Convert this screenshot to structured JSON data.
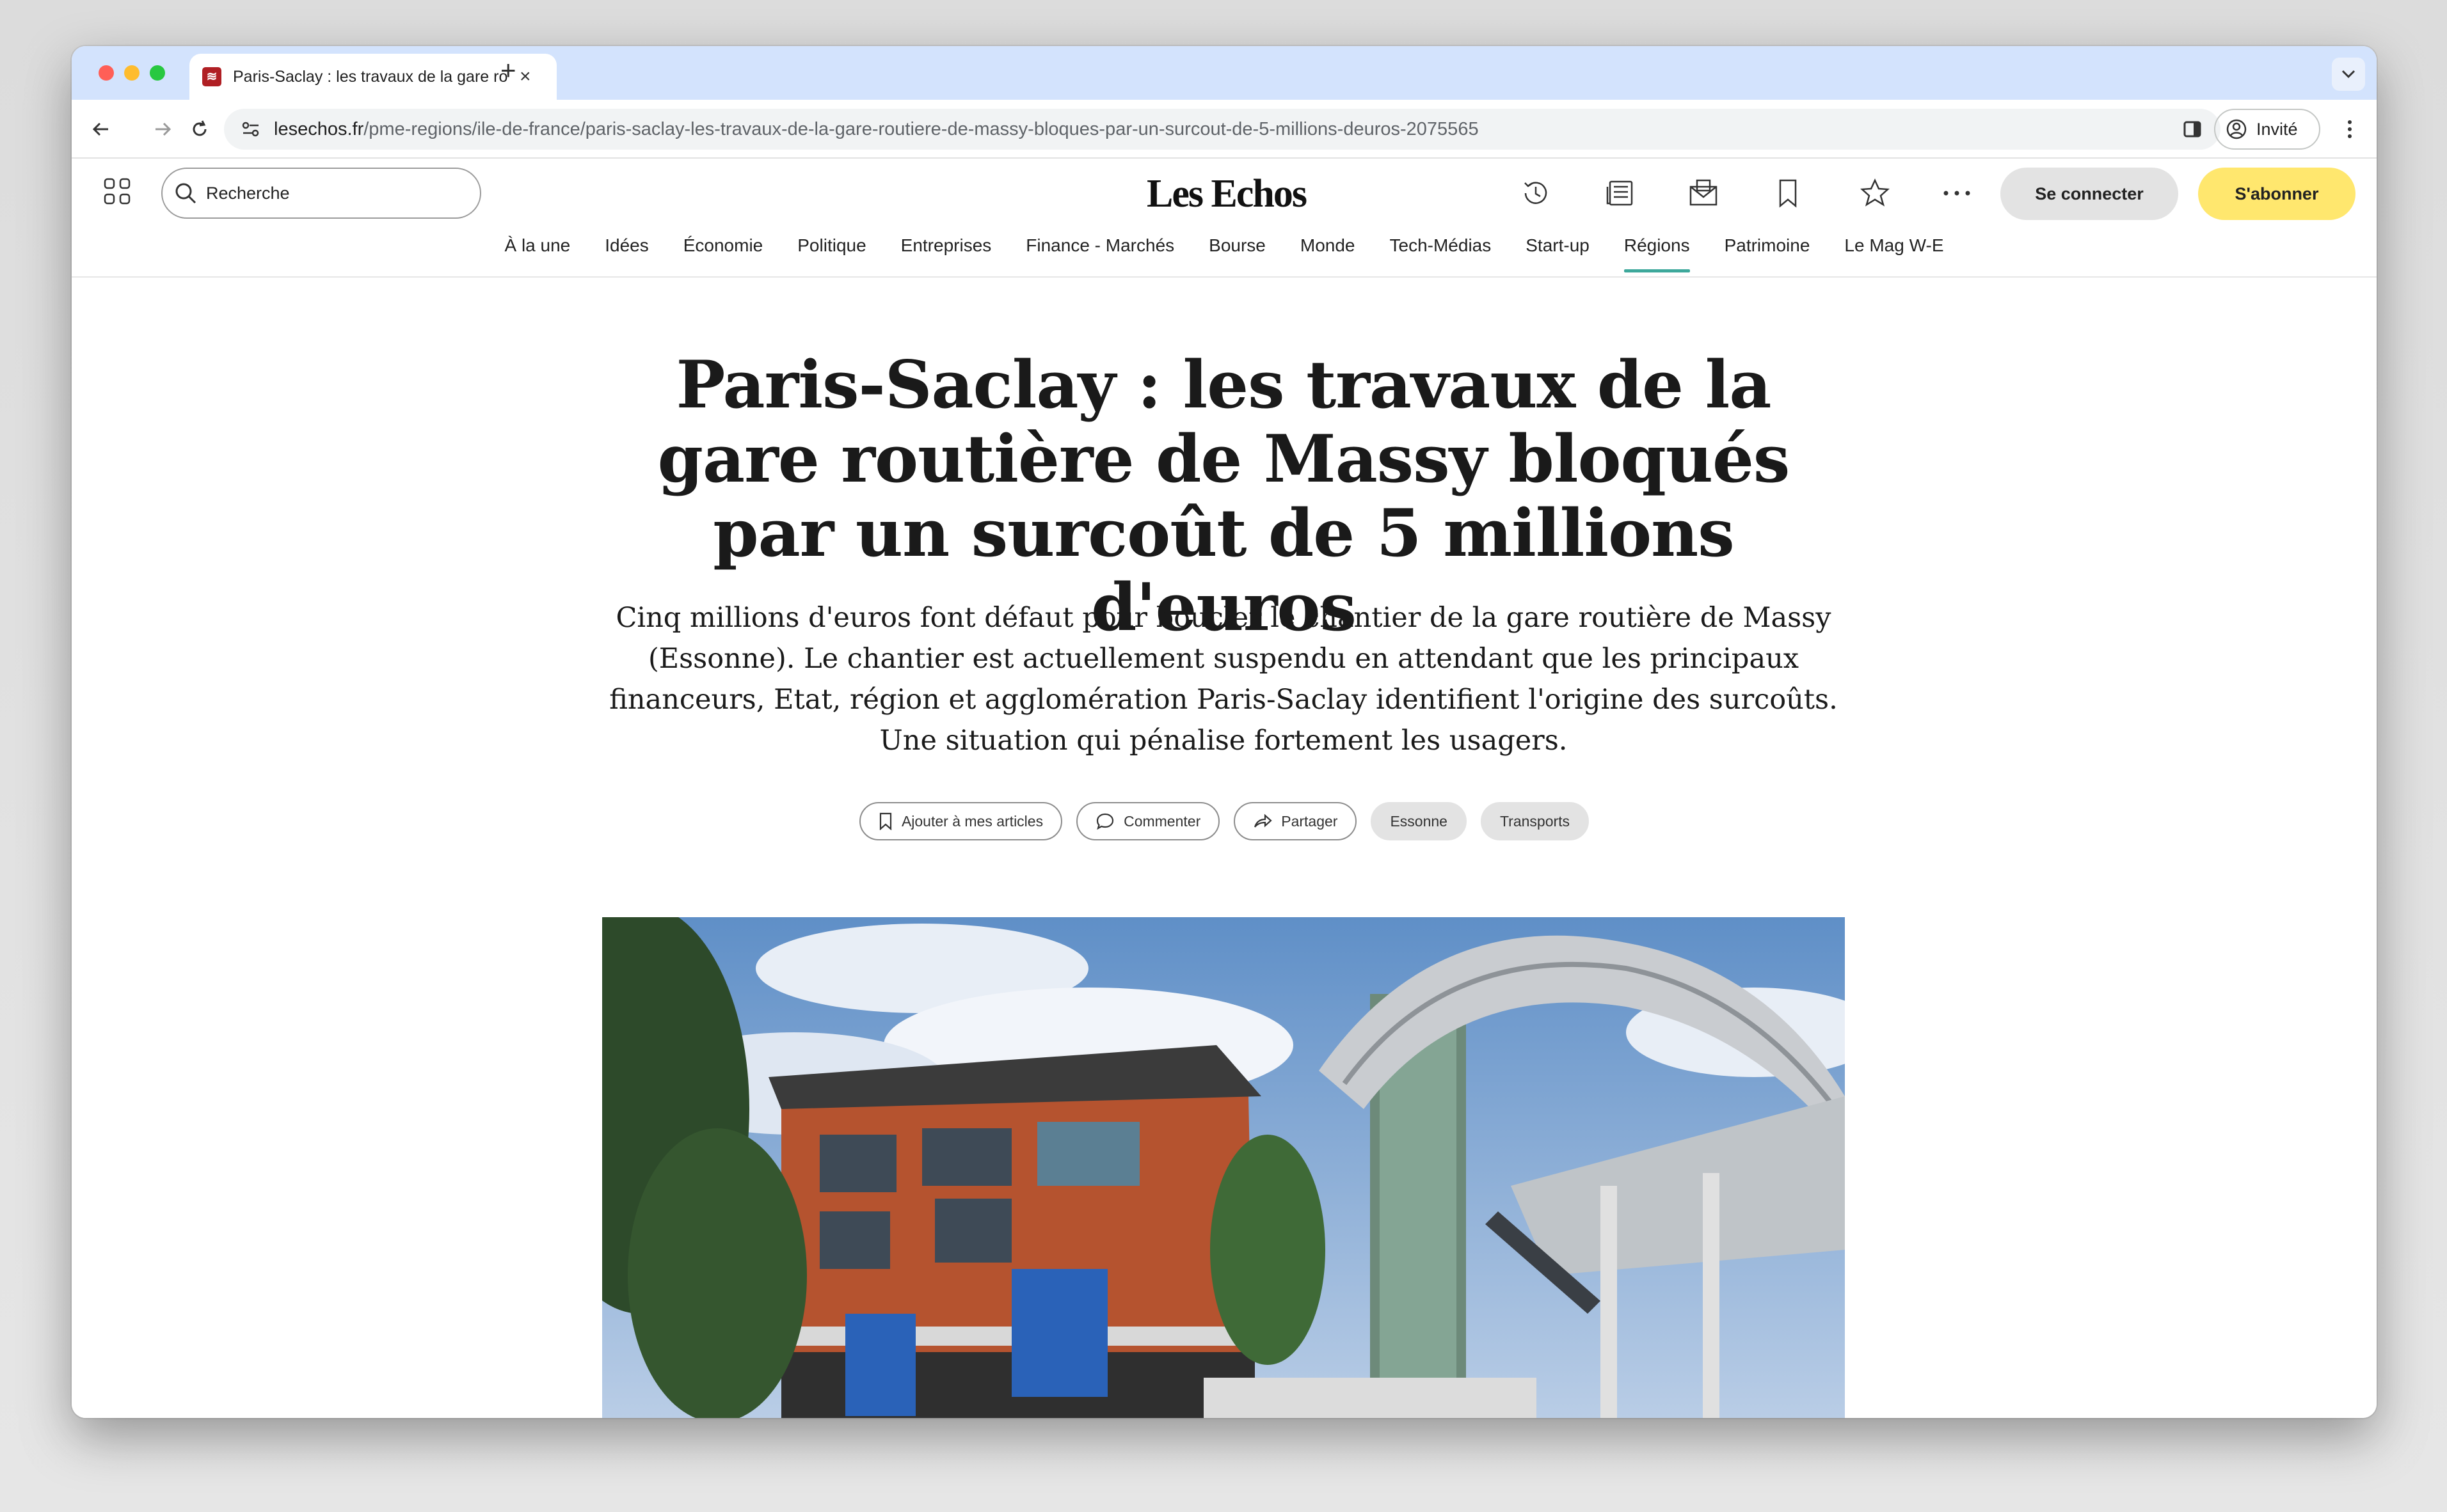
{
  "browser": {
    "tab_title": "Paris-Saclay : les travaux de la gare routière",
    "url_host": "lesechos.fr",
    "url_path": "/pme-regions/ile-de-france/paris-saclay-les-travaux-de-la-gare-routiere-de-massy-bloques-par-un-surcout-de-5-millions-deuros-2075565",
    "profile_label": "Invité"
  },
  "site": {
    "logo": "Les Echos",
    "search_placeholder": "Recherche",
    "connect_label": "Se connecter",
    "subscribe_label": "S'abonner",
    "nav": [
      "À la une",
      "Idées",
      "Économie",
      "Politique",
      "Entreprises",
      "Finance - Marchés",
      "Bourse",
      "Monde",
      "Tech-Médias",
      "Start-up",
      "Régions",
      "Patrimoine",
      "Le Mag W-E"
    ],
    "active_nav": "Régions"
  },
  "article": {
    "headline": "Paris-Saclay : les travaux de la gare routière de Massy bloqués par un surcoût de 5 millions d'euros",
    "lede": "Cinq millions d'euros font défaut pour boucler le chantier de la gare routière de Massy (Essonne). Le chantier est actuellement suspendu en attendant que les principaux financeurs, Etat, région et agglomération Paris-Saclay identifient l'origine des surcoûts. Une situation qui pénalise fortement les usagers.",
    "actions": {
      "save": "Ajouter à mes articles",
      "comment": "Commenter",
      "share": "Partager"
    },
    "tags": [
      "Essonne",
      "Transports"
    ]
  },
  "colors": {
    "accent_nav": "#3da89b",
    "subscribe_bg": "#ffe76e",
    "tabstrip_bg": "#d3e3fd"
  }
}
